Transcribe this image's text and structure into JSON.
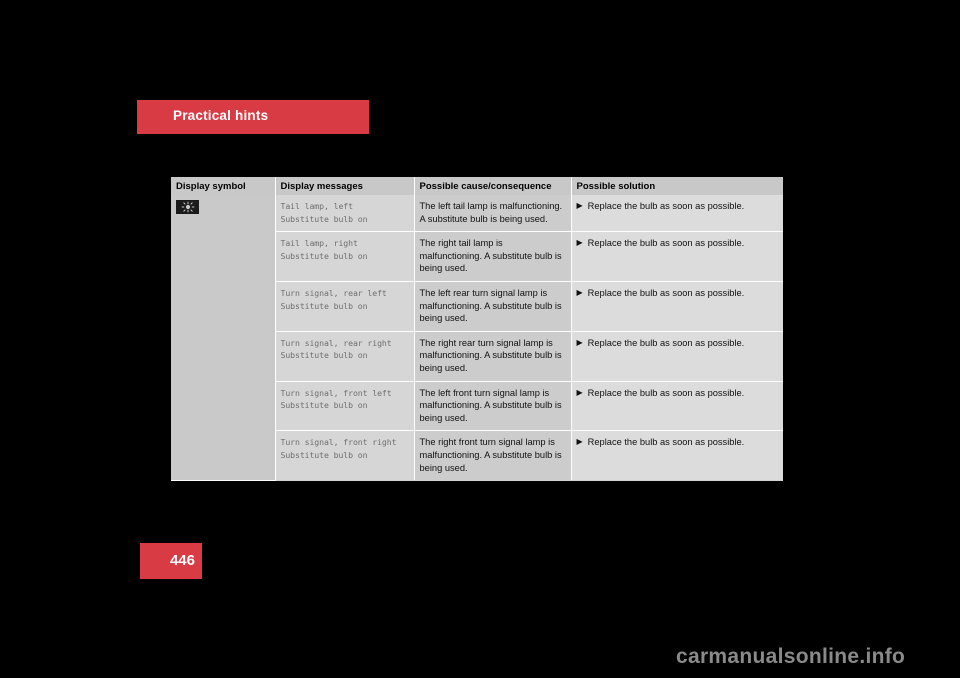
{
  "chapter": {
    "title": "Practical hints"
  },
  "page": {
    "number": "446",
    "watermark": "carmanualsonline.info",
    "background_color": "#000000",
    "accent_color": "#d93b44"
  },
  "table": {
    "headers": [
      "Display symbol",
      "Display messages",
      "Possible cause/consequence",
      "Possible solution"
    ],
    "symbol": {
      "icon": "lamp-bulb-indicator-icon",
      "background_color": "#1b1b1b",
      "glyph_color": "#c8c8c8"
    },
    "rows": [
      {
        "message_line1": "Tail lamp, left",
        "message_line2": "Substitute bulb on",
        "cause": "The left tail lamp is malfunctioning. A substitute bulb is being used.",
        "solution_bullet": "▶",
        "solution": "Replace the bulb as soon as possible."
      },
      {
        "message_line1": "Tail lamp, right",
        "message_line2": "Substitute bulb on",
        "cause": "The right tail lamp is malfunctioning. A substitute bulb is being used.",
        "solution_bullet": "▶",
        "solution": "Replace the bulb as soon as possible."
      },
      {
        "message_line1": "Turn signal, rear left",
        "message_line2": "Substitute bulb on",
        "cause": "The left rear turn signal lamp is malfunctioning. A substitute bulb is being used.",
        "solution_bullet": "▶",
        "solution": "Replace the bulb as soon as possible."
      },
      {
        "message_line1": "Turn signal, rear right",
        "message_line2": "Substitute bulb on",
        "cause": "The right rear turn signal lamp is malfunctioning. A substitute bulb is being used.",
        "solution_bullet": "▶",
        "solution": "Replace the bulb as soon as possible."
      },
      {
        "message_line1": "Turn signal, front left",
        "message_line2": "Substitute bulb on",
        "cause": "The left front turn signal lamp is malfunctioning. A substitute bulb is being used.",
        "solution_bullet": "▶",
        "solution": "Replace the bulb as soon as possible."
      },
      {
        "message_line1": "Turn signal, front right",
        "message_line2": "Substitute bulb on",
        "cause": "The right front turn signal lamp is malfunctioning. A substitute bulb is being used.",
        "solution_bullet": "▶",
        "solution": "Replace the bulb as soon as possible."
      }
    ]
  }
}
